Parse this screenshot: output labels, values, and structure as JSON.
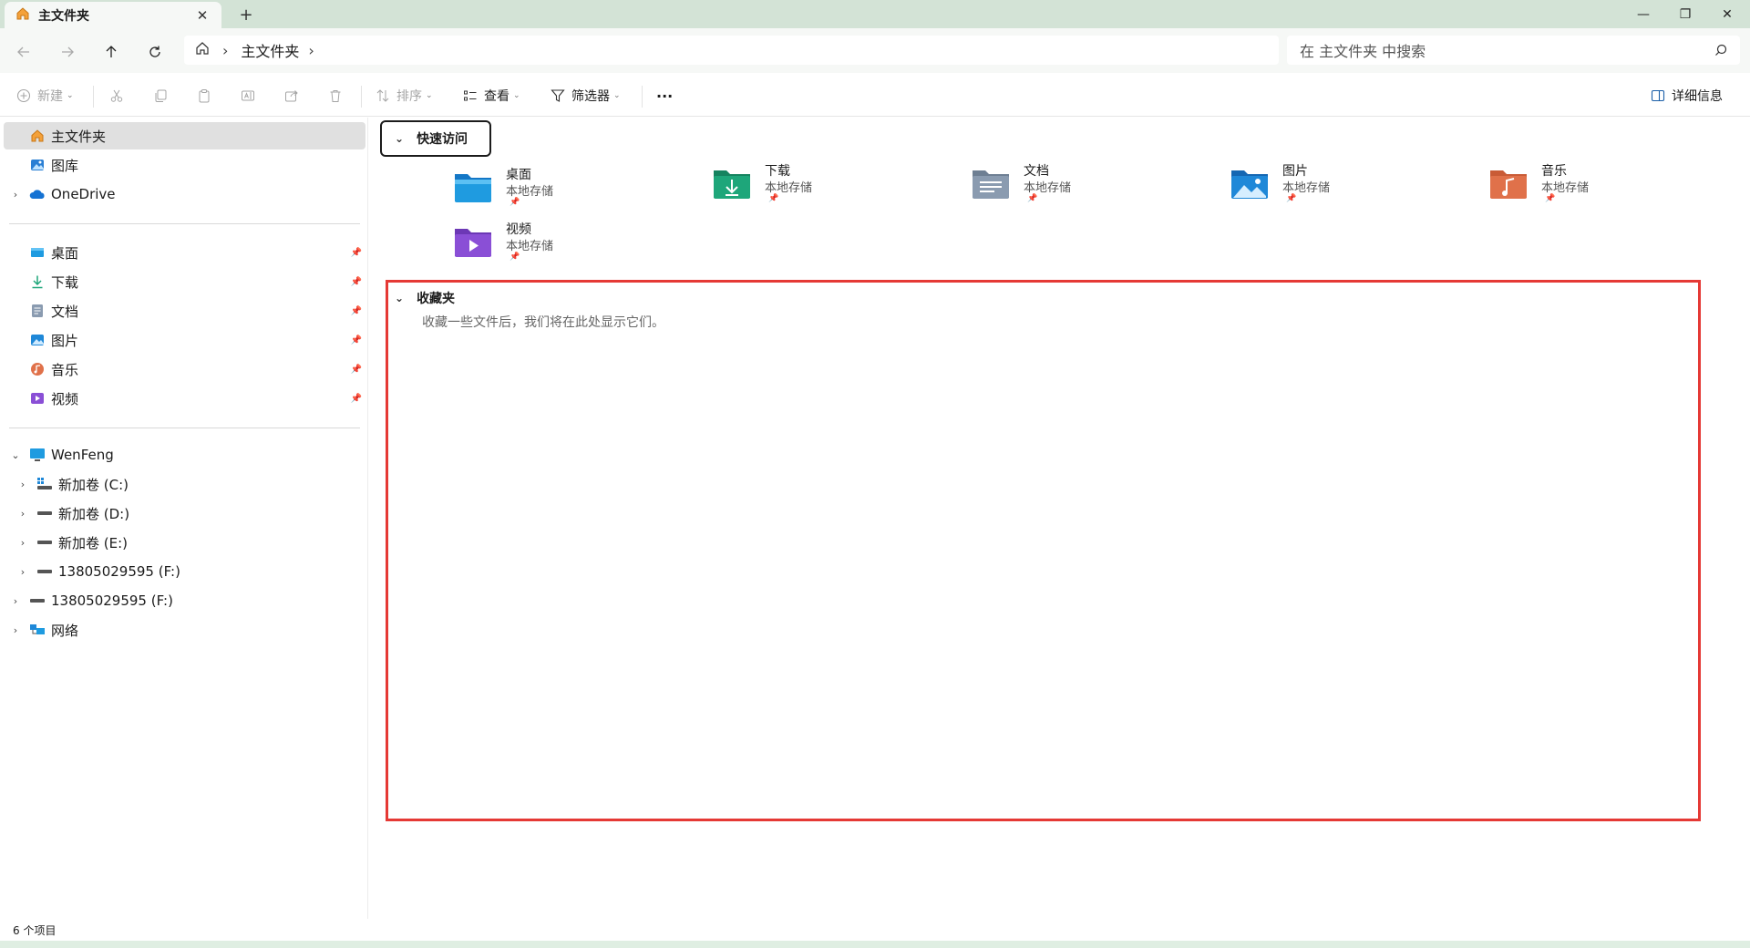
{
  "window": {
    "tab_title": "主文件夹",
    "tab_close": "✕",
    "new_tab": "+",
    "minimize": "—",
    "maximize": "❐",
    "close": "✕"
  },
  "address": {
    "crumb": "主文件夹",
    "search_placeholder": "在 主文件夹 中搜索"
  },
  "toolbar": {
    "new_label": "新建",
    "sort_label": "排序",
    "view_label": "查看",
    "filter_label": "筛选器",
    "more_label": "···",
    "details_label": "详细信息"
  },
  "sidebar": {
    "top": [
      {
        "label": "主文件夹",
        "icon": "home-icon"
      },
      {
        "label": "图库",
        "icon": "gallery-icon"
      },
      {
        "label": "OneDrive",
        "icon": "cloud-icon"
      }
    ],
    "pinned": [
      {
        "label": "桌面",
        "icon": "desktop-icon"
      },
      {
        "label": "下载",
        "icon": "download-icon"
      },
      {
        "label": "文档",
        "icon": "document-icon"
      },
      {
        "label": "图片",
        "icon": "pictures-icon"
      },
      {
        "label": "音乐",
        "icon": "music-icon"
      },
      {
        "label": "视频",
        "icon": "video-icon"
      }
    ],
    "pc": {
      "label": "WenFeng",
      "icon": "computer-icon"
    },
    "drives": [
      {
        "label": "新加卷 (C:)",
        "icon": "windows-drive-icon"
      },
      {
        "label": "新加卷 (D:)",
        "icon": "drive-icon"
      },
      {
        "label": "新加卷 (E:)",
        "icon": "drive-icon"
      },
      {
        "label": "13805029595 (F:)",
        "icon": "drive-icon"
      }
    ],
    "extra": [
      {
        "label": "13805029595 (F:)",
        "icon": "drive-icon"
      },
      {
        "label": "网络",
        "icon": "network-icon"
      }
    ]
  },
  "quick_access": {
    "title": "快速访问",
    "items": [
      {
        "name": "桌面",
        "sub": "本地存储",
        "color": "#1f9be0"
      },
      {
        "name": "下载",
        "sub": "本地存储",
        "color": "#1ea67a"
      },
      {
        "name": "文档",
        "sub": "本地存储",
        "color": "#8a9bb0"
      },
      {
        "name": "图片",
        "sub": "本地存储",
        "color": "#1f88d8"
      },
      {
        "name": "音乐",
        "sub": "本地存储",
        "color": "#e0714a"
      },
      {
        "name": "视频",
        "sub": "本地存储",
        "color": "#8a4fd6"
      }
    ]
  },
  "favorites": {
    "title": "收藏夹",
    "empty_text": "收藏一些文件后，我们将在此处显示它们。",
    "highlight_color": "#e53935"
  },
  "status": {
    "count": "6 个项目"
  }
}
